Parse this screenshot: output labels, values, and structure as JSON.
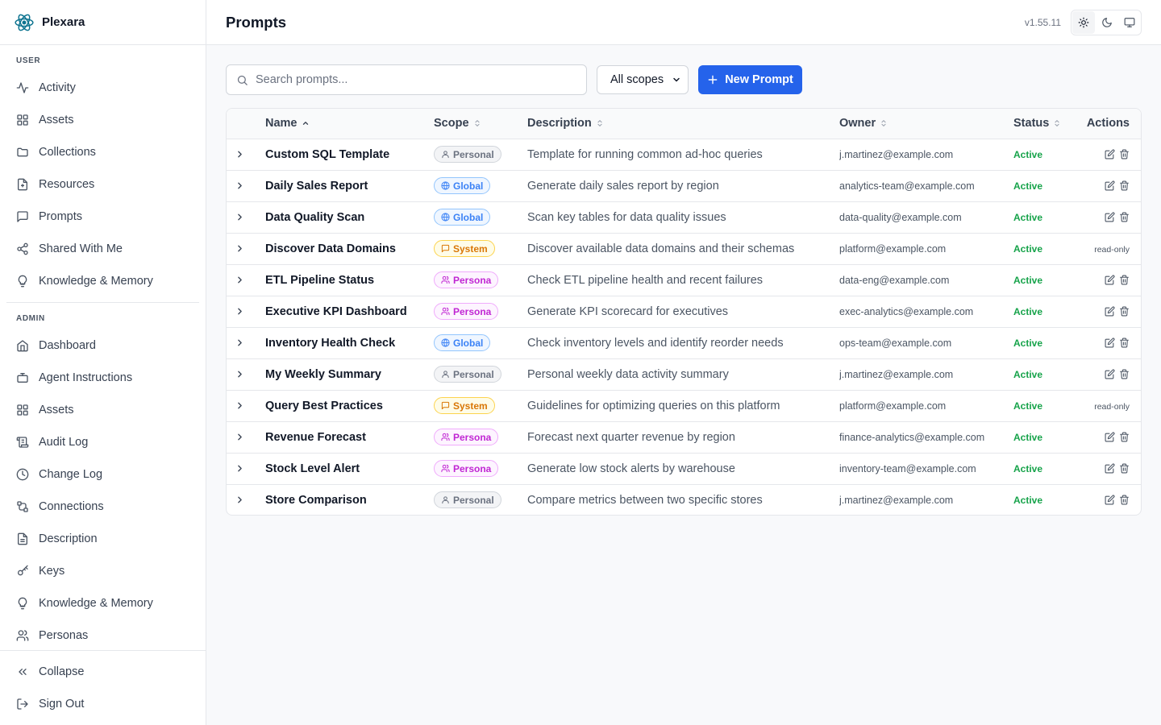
{
  "app": {
    "name": "Plexara",
    "version": "v1.55.11"
  },
  "header": {
    "title": "Prompts"
  },
  "sidebar": {
    "user_label": "USER",
    "user_items": [
      {
        "label": "Activity",
        "icon": "activity-icon"
      },
      {
        "label": "Assets",
        "icon": "grid-icon"
      },
      {
        "label": "Collections",
        "icon": "folder-icon"
      },
      {
        "label": "Resources",
        "icon": "file-plus-icon"
      },
      {
        "label": "Prompts",
        "icon": "message-icon"
      },
      {
        "label": "Shared With Me",
        "icon": "share-icon"
      },
      {
        "label": "Knowledge & Memory",
        "icon": "lightbulb-icon"
      }
    ],
    "admin_label": "ADMIN",
    "admin_items": [
      {
        "label": "Dashboard",
        "icon": "home-icon"
      },
      {
        "label": "Agent Instructions",
        "icon": "bot-icon"
      },
      {
        "label": "Assets",
        "icon": "grid-icon"
      },
      {
        "label": "Audit Log",
        "icon": "scroll-icon"
      },
      {
        "label": "Change Log",
        "icon": "clock-icon"
      },
      {
        "label": "Connections",
        "icon": "connections-icon"
      },
      {
        "label": "Description",
        "icon": "file-text-icon"
      },
      {
        "label": "Keys",
        "icon": "key-icon"
      },
      {
        "label": "Knowledge & Memory",
        "icon": "lightbulb-icon"
      },
      {
        "label": "Personas",
        "icon": "users-icon"
      }
    ],
    "bottom_items": [
      {
        "label": "Collapse",
        "icon": "chevrons-left-icon"
      },
      {
        "label": "Sign Out",
        "icon": "log-out-icon"
      }
    ]
  },
  "toolbar": {
    "search_placeholder": "Search prompts...",
    "search_value": "",
    "scope_selected": "All scopes",
    "new_button_label": "New Prompt"
  },
  "table": {
    "columns": {
      "name": "Name",
      "scope": "Scope",
      "description": "Description",
      "owner": "Owner",
      "status": "Status",
      "actions": "Actions"
    },
    "rows": [
      {
        "name": "Custom SQL Template",
        "scope": "Personal",
        "description": "Template for running common ad-hoc queries",
        "owner": "j.martinez@example.com",
        "status": "Active",
        "actions": "edit-delete"
      },
      {
        "name": "Daily Sales Report",
        "scope": "Global",
        "description": "Generate daily sales report by region",
        "owner": "analytics-team@example.com",
        "status": "Active",
        "actions": "edit-delete"
      },
      {
        "name": "Data Quality Scan",
        "scope": "Global",
        "description": "Scan key tables for data quality issues",
        "owner": "data-quality@example.com",
        "status": "Active",
        "actions": "edit-delete"
      },
      {
        "name": "Discover Data Domains",
        "scope": "System",
        "description": "Discover available data domains and their schemas",
        "owner": "platform@example.com",
        "status": "Active",
        "actions": "read-only"
      },
      {
        "name": "ETL Pipeline Status",
        "scope": "Persona",
        "description": "Check ETL pipeline health and recent failures",
        "owner": "data-eng@example.com",
        "status": "Active",
        "actions": "edit-delete"
      },
      {
        "name": "Executive KPI Dashboard",
        "scope": "Persona",
        "description": "Generate KPI scorecard for executives",
        "owner": "exec-analytics@example.com",
        "status": "Active",
        "actions": "edit-delete"
      },
      {
        "name": "Inventory Health Check",
        "scope": "Global",
        "description": "Check inventory levels and identify reorder needs",
        "owner": "ops-team@example.com",
        "status": "Active",
        "actions": "edit-delete"
      },
      {
        "name": "My Weekly Summary",
        "scope": "Personal",
        "description": "Personal weekly data activity summary",
        "owner": "j.martinez@example.com",
        "status": "Active",
        "actions": "edit-delete"
      },
      {
        "name": "Query Best Practices",
        "scope": "System",
        "description": "Guidelines for optimizing queries on this platform",
        "owner": "platform@example.com",
        "status": "Active",
        "actions": "read-only"
      },
      {
        "name": "Revenue Forecast",
        "scope": "Persona",
        "description": "Forecast next quarter revenue by region",
        "owner": "finance-analytics@example.com",
        "status": "Active",
        "actions": "edit-delete"
      },
      {
        "name": "Stock Level Alert",
        "scope": "Persona",
        "description": "Generate low stock alerts by warehouse",
        "owner": "inventory-team@example.com",
        "status": "Active",
        "actions": "edit-delete"
      },
      {
        "name": "Store Comparison",
        "scope": "Personal",
        "description": "Compare metrics between two specific stores",
        "owner": "j.martinez@example.com",
        "status": "Active",
        "actions": "edit-delete"
      }
    ]
  },
  "colors": {
    "accent": "#2563eb",
    "active_status": "#16a34a"
  }
}
